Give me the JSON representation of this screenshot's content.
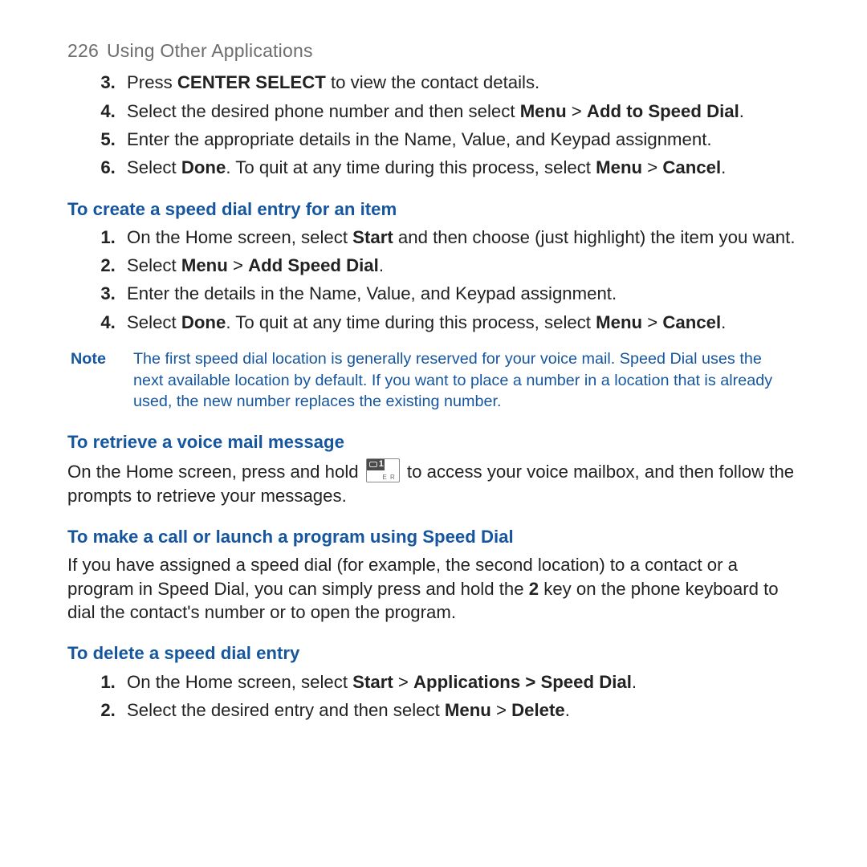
{
  "header": {
    "page_number": "226",
    "title": "Using Other Applications"
  },
  "section1_steps": {
    "s3_pre": "Press ",
    "s3_bold": "CENTER SELECT",
    "s3_post": " to view the contact details.",
    "s4_pre": "Select the desired phone number and then select ",
    "s4_b1": "Menu",
    "s4_mid": " > ",
    "s4_b2": "Add to Speed Dial",
    "s4_post": ".",
    "s5": "Enter the appropriate details in the Name, Value, and Keypad assignment.",
    "s6_pre": "Select ",
    "s6_b1": "Done",
    "s6_mid": ". To quit at any time during this process, select ",
    "s6_b2": "Menu",
    "s6_mid2": " > ",
    "s6_b3": "Cancel",
    "s6_post": "."
  },
  "heading_create": "To create a speed dial entry for an item",
  "create_steps": {
    "s1_pre": "On the Home screen, select ",
    "s1_b1": "Start",
    "s1_post": " and then choose (just highlight) the item you want.",
    "s2_pre": "Select ",
    "s2_b1": "Menu",
    "s2_mid": " > ",
    "s2_b2": "Add Speed Dial",
    "s2_post": ".",
    "s3": "Enter the details in the Name, Value, and Keypad assignment.",
    "s4_pre": "Select ",
    "s4_b1": "Done",
    "s4_mid": ". To quit at any time during this process, select ",
    "s4_b2": "Menu",
    "s4_mid2": " > ",
    "s4_b3": "Cancel",
    "s4_post": "."
  },
  "note": {
    "label": "Note",
    "text": "The first speed dial location is generally reserved for your voice mail. Speed Dial uses the next available location by default. If you want to place a number in a location that is already used, the new number replaces the existing number."
  },
  "heading_retrieve": "To retrieve a voice mail message",
  "retrieve": {
    "pre": "On the Home screen, press and hold ",
    "post": " to access your voice mailbox, and then follow the prompts to retrieve your messages."
  },
  "heading_call": "To make a call or launch a program using Speed Dial",
  "call_body": {
    "pre": "If you have assigned a speed dial (for example, the second location) to a contact or a program in Speed Dial, you can simply press and hold the ",
    "bold": "2",
    "post": " key on the phone keyboard to dial the contact's number or to open the program."
  },
  "heading_delete": "To delete a speed dial entry",
  "delete_steps": {
    "s1_pre": "On the Home screen, select ",
    "s1_b1": "Start",
    "s1_mid1": " > ",
    "s1_b2": "Applications > Speed Dial",
    "s1_post": ".",
    "s2_pre": "Select the desired entry and then select ",
    "s2_b1": "Menu",
    "s2_mid": " > ",
    "s2_b2": "Delete",
    "s2_post": "."
  }
}
